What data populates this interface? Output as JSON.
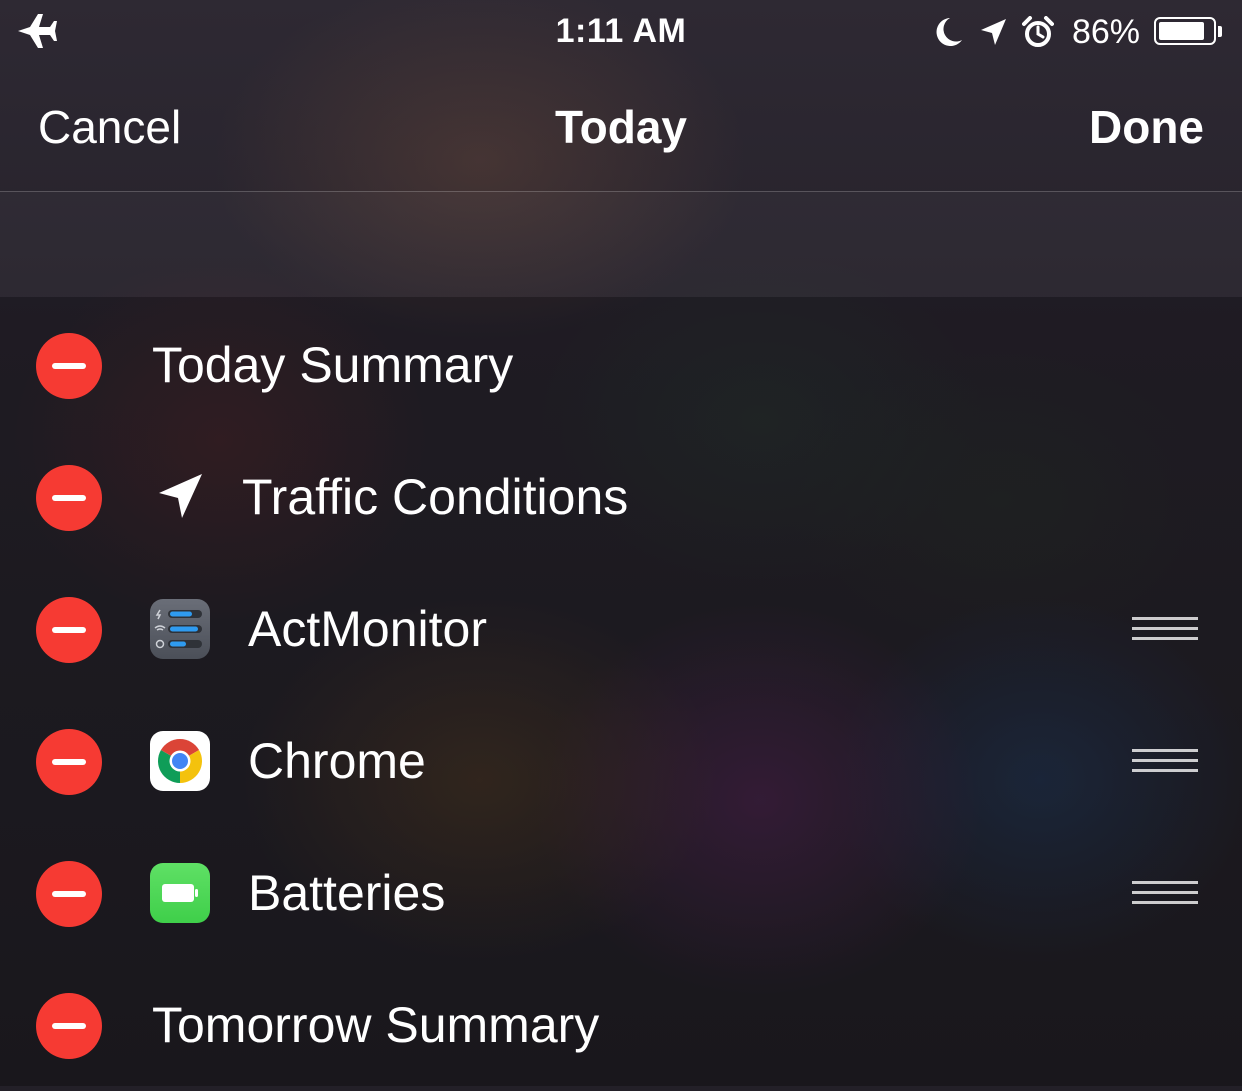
{
  "status_bar": {
    "time": "1:11 AM",
    "battery_percent": "86%",
    "battery_level": 0.86,
    "icons": [
      "airplane-icon",
      "moon-icon",
      "location-arrow-icon",
      "alarm-icon",
      "battery-icon"
    ]
  },
  "nav": {
    "cancel_label": "Cancel",
    "title": "Today",
    "done_label": "Done"
  },
  "widgets": [
    {
      "label": "Today Summary",
      "icon": null,
      "reorderable": false
    },
    {
      "label": "Traffic Conditions",
      "icon": "location-arrow-icon",
      "reorderable": false
    },
    {
      "label": "ActMonitor",
      "icon": "actmonitor-app-icon",
      "reorderable": true
    },
    {
      "label": "Chrome",
      "icon": "chrome-app-icon",
      "reorderable": true
    },
    {
      "label": "Batteries",
      "icon": "batteries-app-icon",
      "reorderable": true
    },
    {
      "label": "Tomorrow Summary",
      "icon": null,
      "reorderable": false
    }
  ],
  "colors": {
    "remove_red": "#f63a33",
    "batteries_green": "#4cd964",
    "actmonitor_bar_blue": "#2f9bf0"
  }
}
